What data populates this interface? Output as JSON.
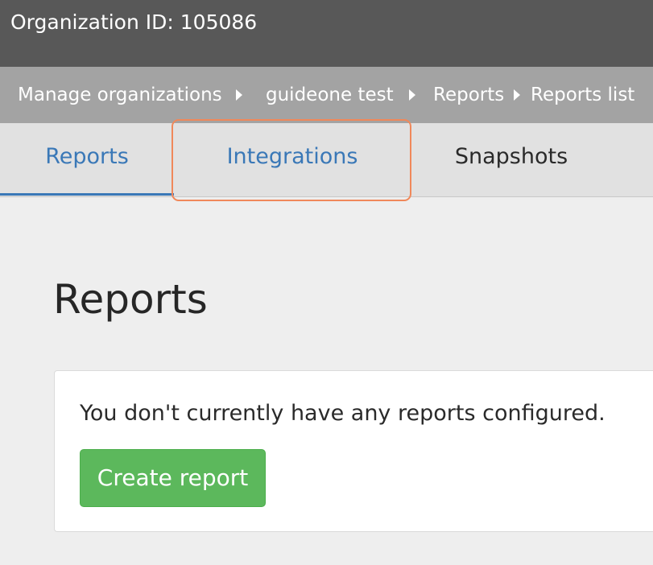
{
  "header": {
    "title": "Organization ID: 105086"
  },
  "breadcrumb": {
    "items": [
      {
        "label": "Manage organizations"
      },
      {
        "label": "guideone test"
      },
      {
        "label": "Reports"
      },
      {
        "label": "Reports list"
      }
    ]
  },
  "tabs": [
    {
      "label": "Reports",
      "active": true
    },
    {
      "label": "Integrations",
      "active": false,
      "highlighted": true
    },
    {
      "label": "Snapshots",
      "active": false
    }
  ],
  "main": {
    "title": "Reports",
    "empty_message": "You don't currently have any reports configured.",
    "create_button_label": "Create report"
  },
  "colors": {
    "header_bg": "#585858",
    "breadcrumb_bg": "#a3a3a3",
    "tab_link": "#3a78b7",
    "highlight_border": "#f0885a",
    "primary_button": "#5cb85c"
  }
}
